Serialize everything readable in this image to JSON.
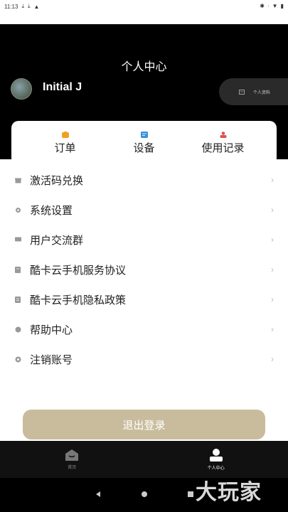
{
  "status_bar": {
    "time": "11:13"
  },
  "header": {
    "title": "个人中心",
    "username": "Initial J",
    "profile_button_label": "个人资料"
  },
  "quick_actions": [
    {
      "label": "订单",
      "icon": "order-icon",
      "color": "#f0a020"
    },
    {
      "label": "设备",
      "icon": "device-icon",
      "color": "#3a8fe0"
    },
    {
      "label": "使用记录",
      "icon": "record-icon",
      "color": "#e05050"
    }
  ],
  "menu": [
    {
      "label": "激活码兑换",
      "icon": "gift-icon"
    },
    {
      "label": "系统设置",
      "icon": "gear-icon"
    },
    {
      "label": "用户交流群",
      "icon": "chat-icon"
    },
    {
      "label": "酷卡云手机服务协议",
      "icon": "document-icon"
    },
    {
      "label": "酷卡云手机隐私政策",
      "icon": "privacy-icon"
    },
    {
      "label": "帮助中心",
      "icon": "help-icon"
    },
    {
      "label": "注销账号",
      "icon": "cancel-account-icon"
    }
  ],
  "logout_label": "退出登录",
  "tabs": [
    {
      "label": "首页",
      "icon": "home-icon",
      "active": false
    },
    {
      "label": "个人中心",
      "icon": "user-icon",
      "active": true
    }
  ],
  "watermark": "大玩家",
  "colors": {
    "accent": "#c9bc9c",
    "header_bg": "#000000"
  }
}
